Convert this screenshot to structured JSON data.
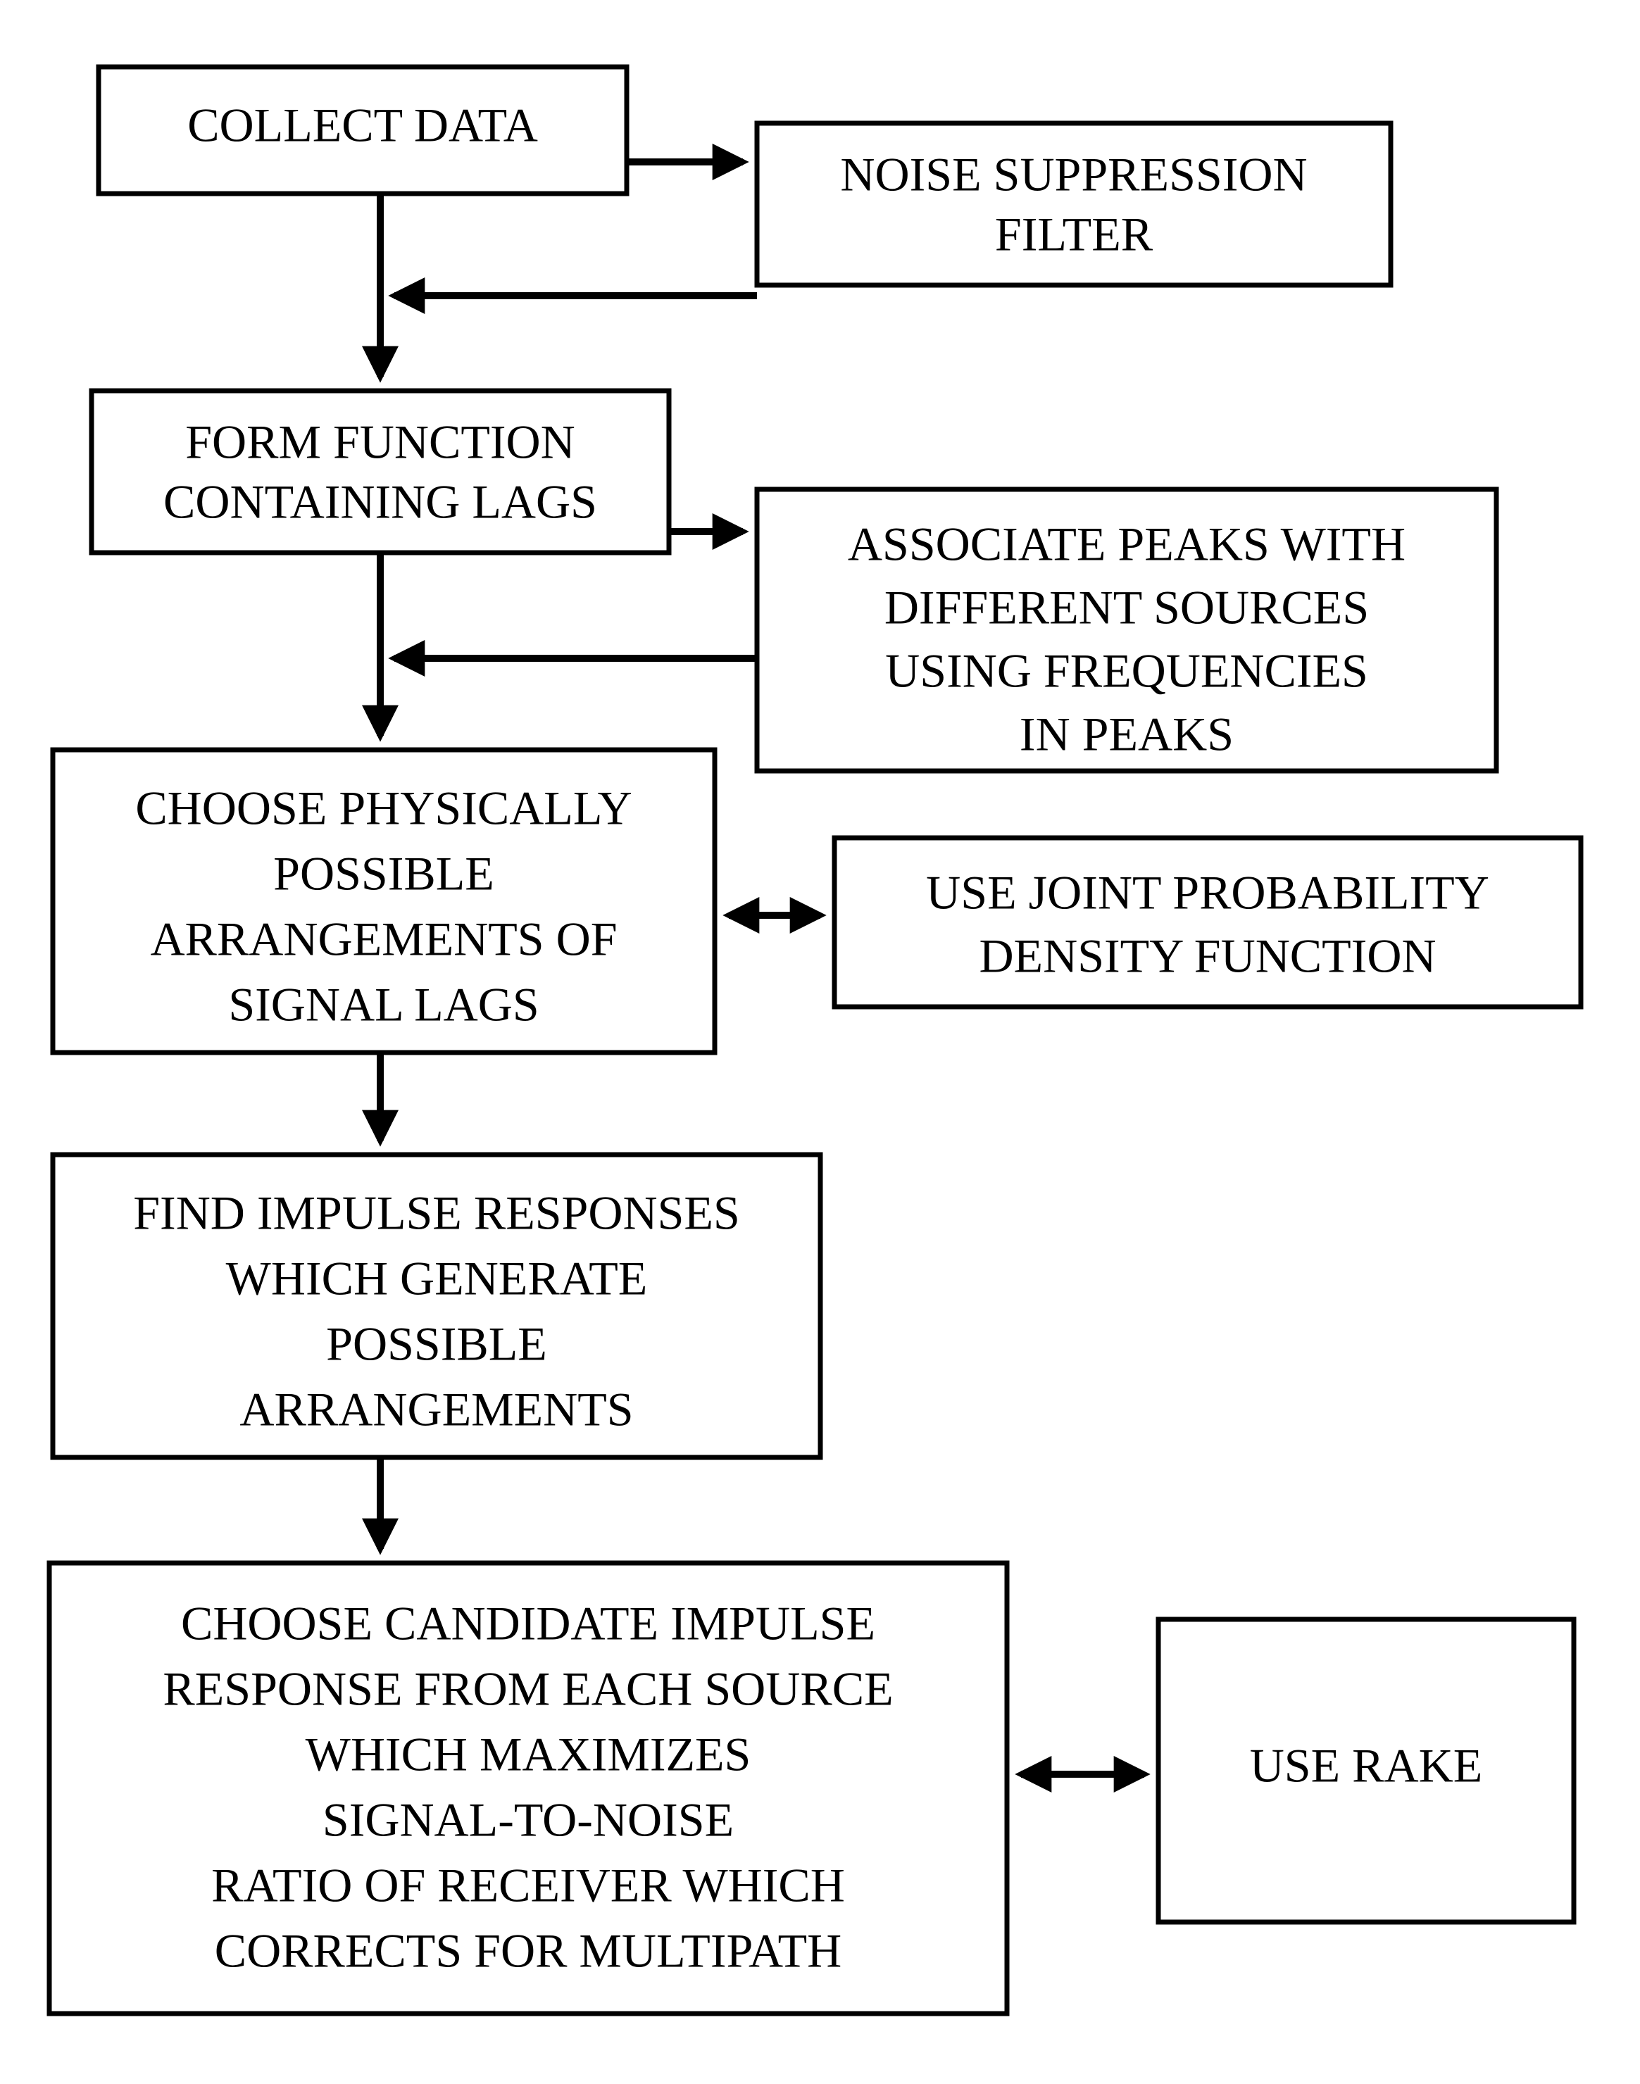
{
  "chart_data": {
    "type": "flowchart",
    "nodes": [
      {
        "id": "n1",
        "lines": [
          "COLLECT DATA"
        ]
      },
      {
        "id": "n2",
        "lines": [
          "NOISE SUPPRESSION",
          "FILTER"
        ]
      },
      {
        "id": "n3",
        "lines": [
          "FORM FUNCTION",
          "CONTAINING LAGS"
        ]
      },
      {
        "id": "n4",
        "lines": [
          "ASSOCIATE PEAKS WITH",
          "DIFFERENT SOURCES",
          "USING  FREQUENCIES",
          "IN PEAKS"
        ]
      },
      {
        "id": "n5",
        "lines": [
          "CHOOSE PHYSICALLY",
          "POSSIBLE",
          "ARRANGEMENTS OF",
          "SIGNAL LAGS"
        ]
      },
      {
        "id": "n6",
        "lines": [
          "USE JOINT PROBABILITY",
          "DENSITY FUNCTION"
        ]
      },
      {
        "id": "n7",
        "lines": [
          "FIND IMPULSE RESPONSES",
          "WHICH GENERATE",
          "POSSIBLE",
          "ARRANGEMENTS"
        ]
      },
      {
        "id": "n8",
        "lines": [
          "CHOOSE CANDIDATE IMPULSE",
          "RESPONSE FROM EACH SOURCE",
          "WHICH MAXIMIZES",
          "SIGNAL-TO-NOISE",
          "RATIO OF RECEIVER WHICH",
          "CORRECTS FOR MULTIPATH"
        ]
      },
      {
        "id": "n9",
        "lines": [
          "USE RAKE"
        ]
      }
    ],
    "edges": [
      {
        "from": "n1",
        "to": "n2",
        "type": "normal"
      },
      {
        "from": "n2",
        "to": "vbar1",
        "type": "normal"
      },
      {
        "from": "n1",
        "to": "n3",
        "type": "normal"
      },
      {
        "from": "n3",
        "to": "n4",
        "type": "normal"
      },
      {
        "from": "n4",
        "to": "vbar2",
        "type": "normal"
      },
      {
        "from": "n3",
        "to": "n5",
        "type": "normal"
      },
      {
        "from": "n5",
        "to": "n6",
        "type": "double"
      },
      {
        "from": "n5",
        "to": "n7",
        "type": "normal"
      },
      {
        "from": "n7",
        "to": "n8",
        "type": "normal"
      },
      {
        "from": "n8",
        "to": "n9",
        "type": "double"
      }
    ]
  },
  "nodes": {
    "n1": {
      "l1": "COLLECT DATA"
    },
    "n2": {
      "l1": "NOISE SUPPRESSION",
      "l2": "FILTER"
    },
    "n3": {
      "l1": "FORM FUNCTION",
      "l2": "CONTAINING LAGS"
    },
    "n4": {
      "l1": "ASSOCIATE PEAKS WITH",
      "l2": "DIFFERENT SOURCES",
      "l3": "USING  FREQUENCIES",
      "l4": "IN PEAKS"
    },
    "n5": {
      "l1": "CHOOSE PHYSICALLY",
      "l2": "POSSIBLE",
      "l3": "ARRANGEMENTS OF",
      "l4": "SIGNAL LAGS"
    },
    "n6": {
      "l1": "USE JOINT PROBABILITY",
      "l2": "DENSITY FUNCTION"
    },
    "n7": {
      "l1": "FIND IMPULSE RESPONSES",
      "l2": "WHICH GENERATE",
      "l3": "POSSIBLE",
      "l4": "ARRANGEMENTS"
    },
    "n8": {
      "l1": "CHOOSE CANDIDATE IMPULSE",
      "l2": "RESPONSE FROM EACH SOURCE",
      "l3": "WHICH MAXIMIZES",
      "l4": "SIGNAL-TO-NOISE",
      "l5": "RATIO OF RECEIVER WHICH",
      "l6": "CORRECTS FOR MULTIPATH"
    },
    "n9": {
      "l1": "USE RAKE"
    }
  }
}
